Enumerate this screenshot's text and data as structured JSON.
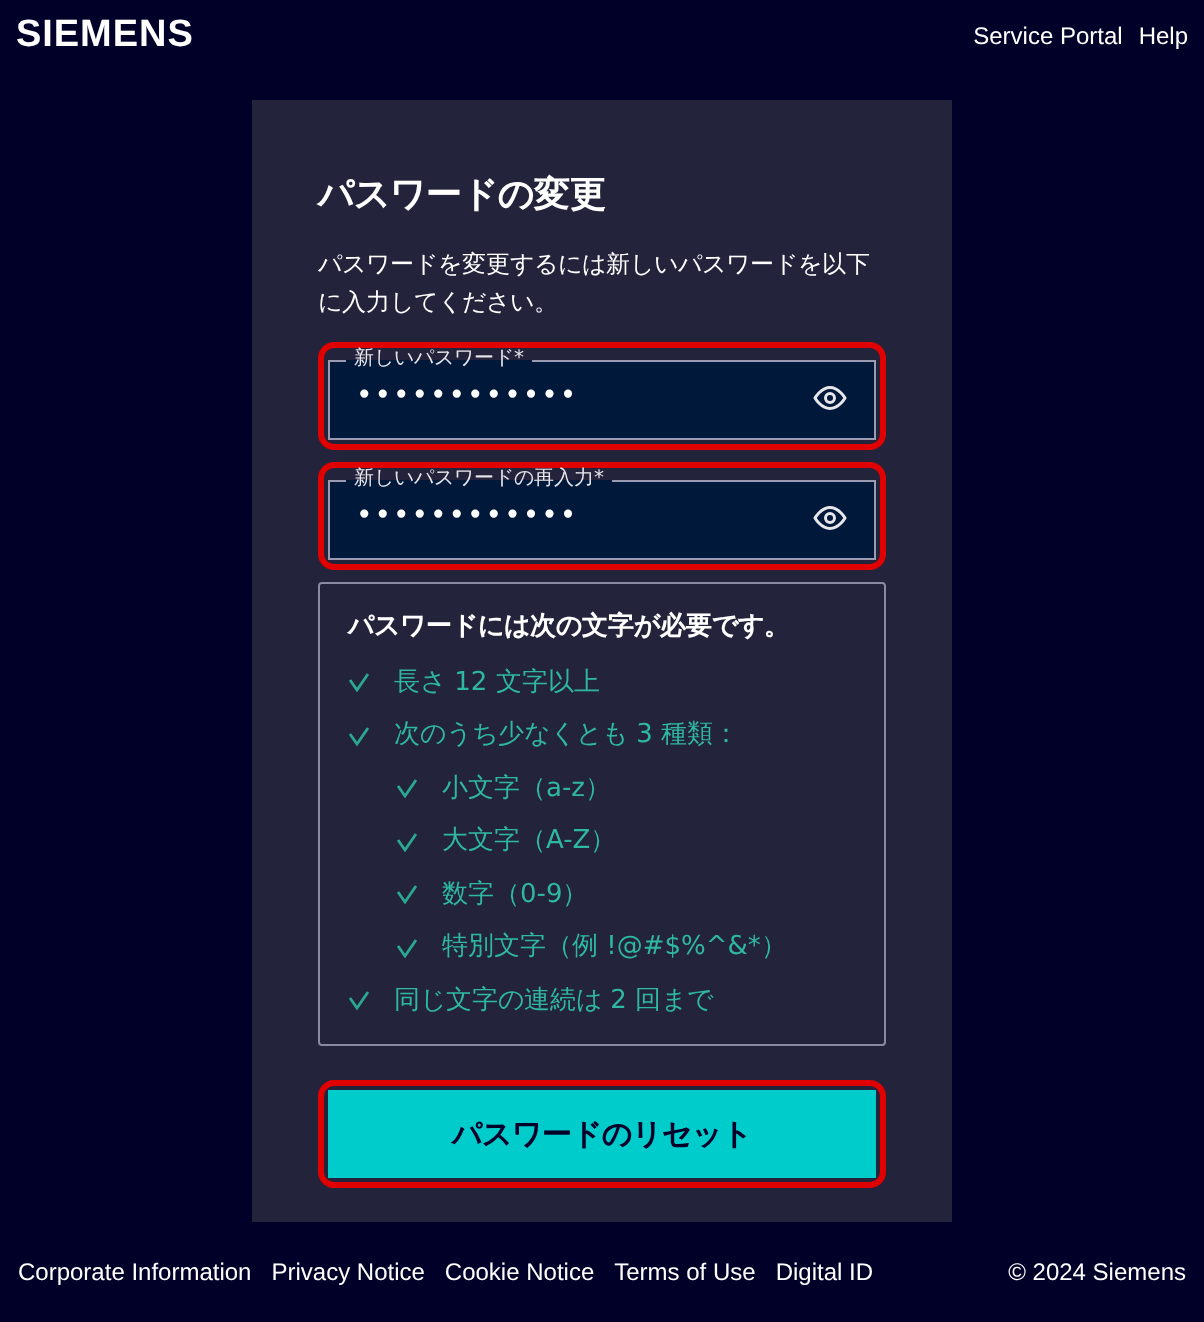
{
  "header": {
    "logo": "SIEMENS",
    "links": [
      "Service Portal",
      "Help"
    ]
  },
  "card": {
    "title": "パスワードの変更",
    "description": "パスワードを変更するには新しいパスワードを以下に入力してください。",
    "fields": [
      {
        "label": "新しいパスワード*",
        "value": "••••••••••••",
        "highlighted": true
      },
      {
        "label": "新しいパスワードの再入力*",
        "value": "••••••••••••",
        "highlighted": true
      }
    ],
    "requirements": {
      "title": "パスワードには次の文字が必要です。",
      "items": [
        {
          "text": "長さ 12 文字以上",
          "checked": true
        },
        {
          "text": "次のうち少なくとも 3 種類：",
          "checked": true,
          "children": [
            {
              "text": "小文字（a-z）",
              "checked": true
            },
            {
              "text": "大文字（A-Z）",
              "checked": true
            },
            {
              "text": "数字（0-9）",
              "checked": true
            },
            {
              "text": "特別文字（例 !@#$%^&*）",
              "checked": true
            }
          ]
        },
        {
          "text": "同じ文字の連続は 2 回まで",
          "checked": true
        }
      ]
    },
    "button": {
      "label": "パスワードのリセット",
      "highlighted": true
    }
  },
  "footer": {
    "links": [
      "Corporate Information",
      "Privacy Notice",
      "Cookie Notice",
      "Terms of Use",
      "Digital ID"
    ],
    "copyright": "© 2024 Siemens"
  }
}
